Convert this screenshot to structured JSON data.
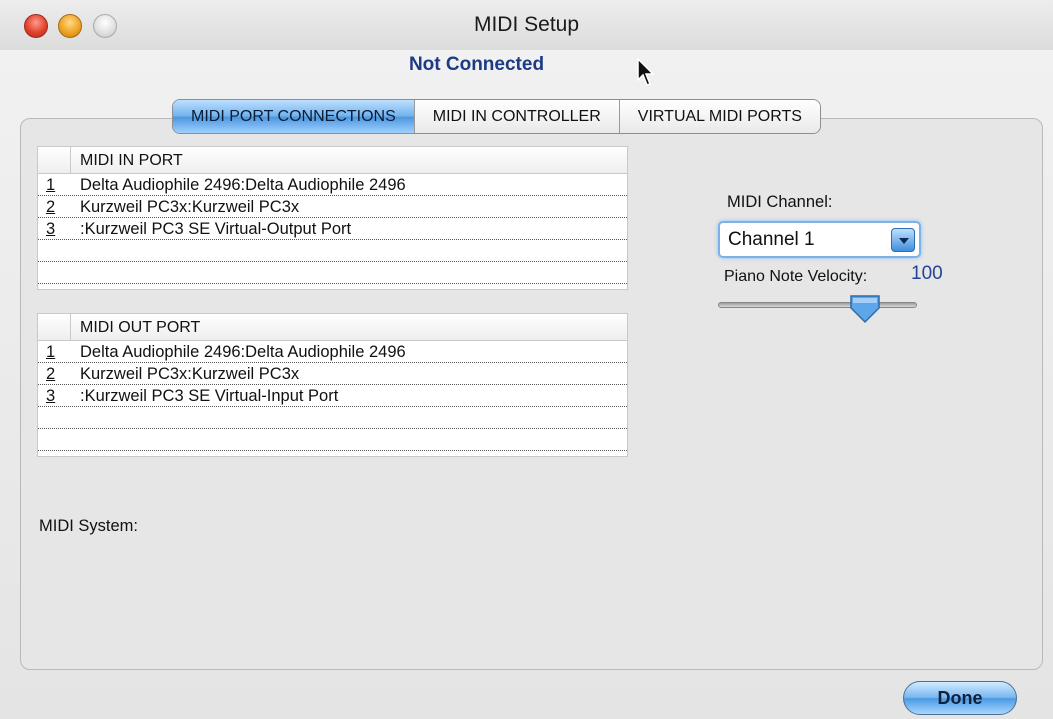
{
  "window": {
    "title": "MIDI Setup"
  },
  "status": {
    "text": "Not Connected",
    "color": "#1d3a86"
  },
  "tabs": [
    {
      "label": "MIDI PORT CONNECTIONS",
      "active": true
    },
    {
      "label": "MIDI IN CONTROLLER",
      "active": false
    },
    {
      "label": "VIRTUAL MIDI PORTS",
      "active": false
    }
  ],
  "midi_in": {
    "header": "MIDI IN PORT",
    "rows": [
      {
        "n": "1",
        "port": "Delta Audiophile 2496:Delta Audiophile 2496"
      },
      {
        "n": "2",
        "port": "Kurzweil PC3x:Kurzweil PC3x"
      },
      {
        "n": "3",
        "port": ":Kurzweil PC3 SE Virtual-Output Port"
      }
    ]
  },
  "midi_out": {
    "header": "MIDI OUT PORT",
    "rows": [
      {
        "n": "1",
        "port": "Delta Audiophile 2496:Delta Audiophile 2496"
      },
      {
        "n": "2",
        "port": "Kurzweil PC3x:Kurzweil PC3x"
      },
      {
        "n": "3",
        "port": ":Kurzweil PC3 SE Virtual-Input Port"
      }
    ]
  },
  "controls": {
    "channel_label": "MIDI Channel:",
    "channel_value": "Channel 1",
    "velocity_label": "Piano Note Velocity:",
    "velocity_value": "100",
    "velocity_slider_fraction": 0.74
  },
  "system_label": "MIDI System:",
  "done_label": "Done",
  "accent_color": "#4a96df"
}
